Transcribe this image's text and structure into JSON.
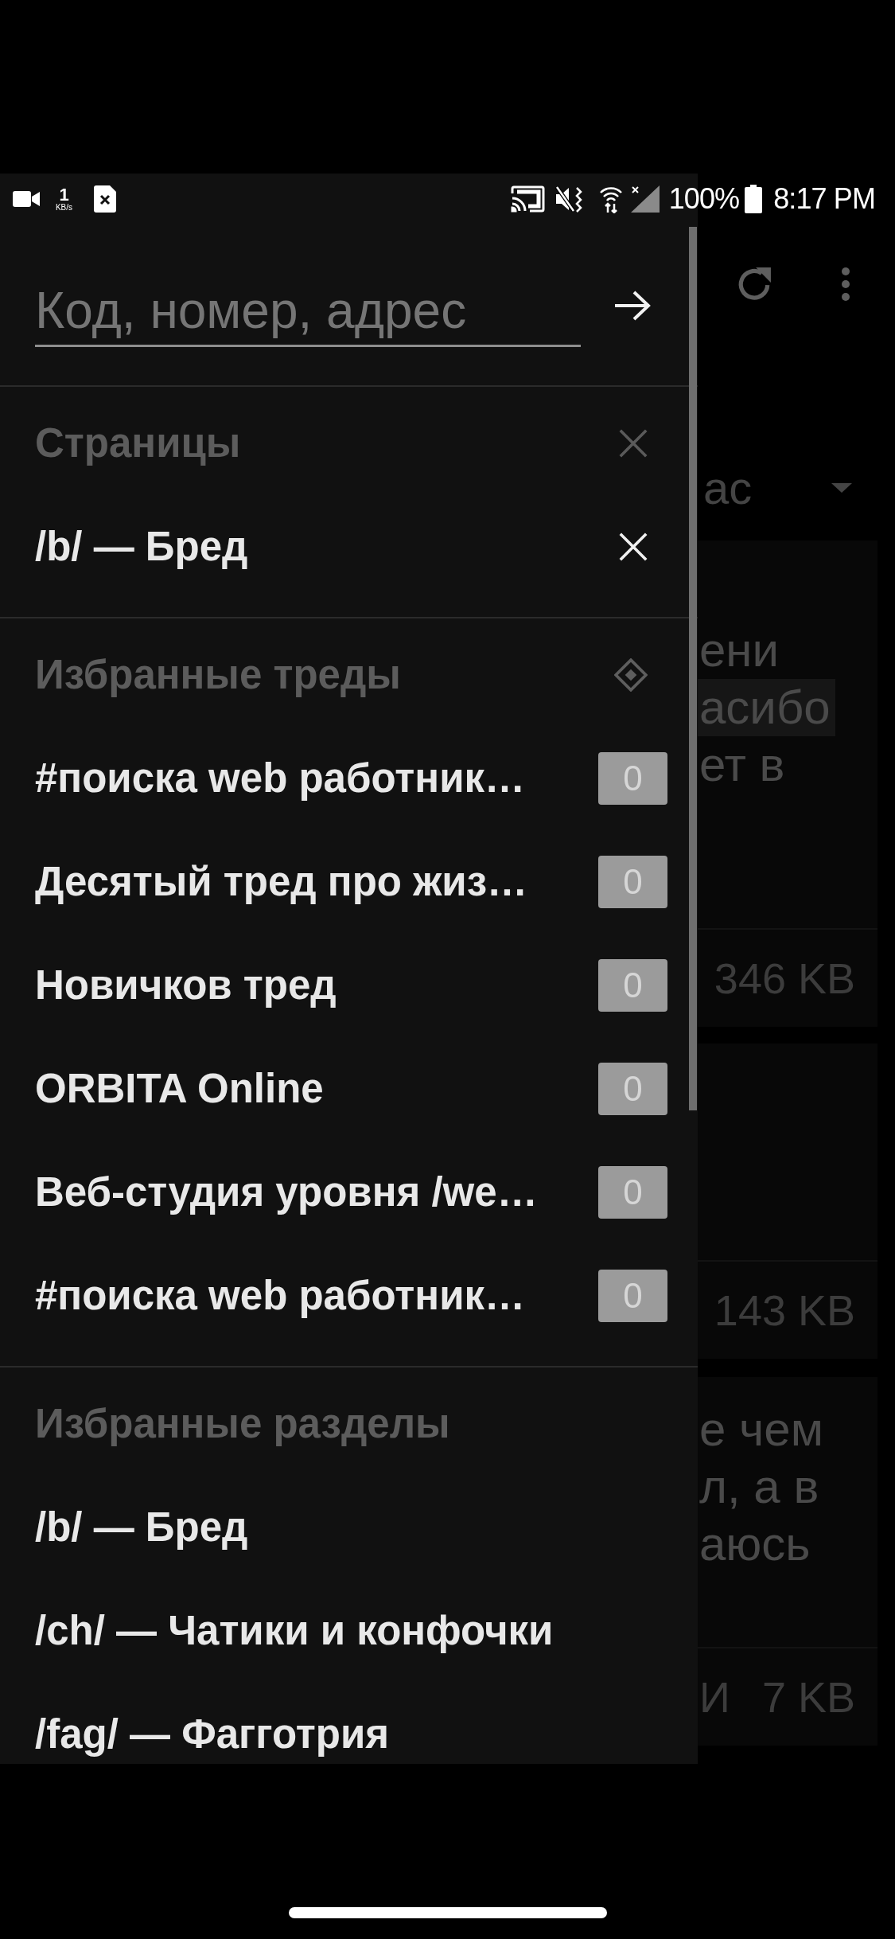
{
  "status_bar": {
    "data_rate": "1",
    "data_rate_unit": "KB/s",
    "battery": "100%",
    "time": "8:17 PM"
  },
  "drawer": {
    "search": {
      "placeholder": "Код, номер, адрес"
    },
    "sections": [
      {
        "kind": "pages",
        "title": "Страницы",
        "items": [
          {
            "label": "/b/ — Бред"
          }
        ]
      },
      {
        "kind": "threads",
        "title": "Избранные треды",
        "items": [
          {
            "label": "#поиска web работник…",
            "unread": "0"
          },
          {
            "label": "Десятый тред про жиз…",
            "unread": "0"
          },
          {
            "label": "Новичков тред",
            "unread": "0"
          },
          {
            "label": "ORBITA Online",
            "unread": "0"
          },
          {
            "label": "Веб-студия уровня /we…",
            "unread": "0"
          },
          {
            "label": "#поиска web работник…",
            "unread": "0"
          }
        ]
      },
      {
        "kind": "boards",
        "title": "Избранные разделы",
        "items": [
          {
            "label": "/b/ — Бред"
          },
          {
            "label": "/ch/ — Чатики и конфочки"
          },
          {
            "label": "/fag/ — Фагготрия"
          }
        ]
      }
    ]
  },
  "background_screen": {
    "sort_label": "ас",
    "posts": [
      {
        "lines": [
          {
            "text": "ени",
            "highlighted": false
          },
          {
            "text": "асибо",
            "highlighted": true
          },
          {
            "text": "ет в",
            "highlighted": false
          }
        ],
        "size": "346 KB"
      },
      {
        "size": "143 KB"
      },
      {
        "lines": [
          {
            "text": "е чем",
            "highlighted": false
          },
          {
            "text": "л, а в",
            "highlighted": false
          },
          {
            "text": "аюсь",
            "highlighted": false
          }
        ],
        "footer_text": "И",
        "size": "7 KB"
      }
    ]
  }
}
